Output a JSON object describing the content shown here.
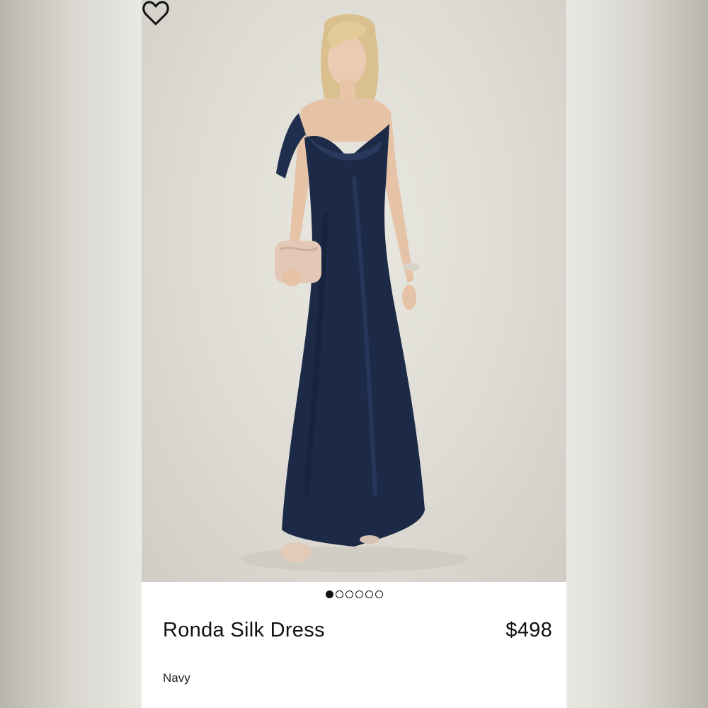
{
  "product": {
    "name": "Ronda Silk Dress",
    "price": "$498",
    "color_name": "Navy"
  },
  "gallery": {
    "image_count": 6,
    "active_index": 0,
    "image_subject": "model wearing navy silk cowl-neck gown holding a blush clutch"
  },
  "icons": {
    "wishlist": "heart-outline-icon"
  },
  "colors": {
    "dress": "#1c2a47",
    "background": "#e4e3dc",
    "text": "#111111"
  }
}
